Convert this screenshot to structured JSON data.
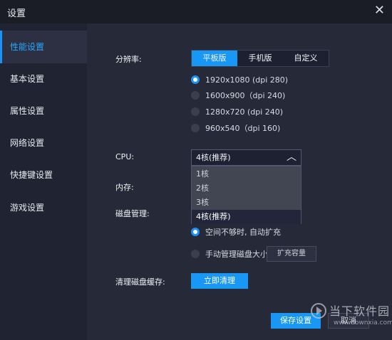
{
  "window": {
    "title": "设置",
    "close_glyph": "✕"
  },
  "sidebar": {
    "items": [
      {
        "label": "性能设置",
        "active": true
      },
      {
        "label": "基本设置"
      },
      {
        "label": "属性设置"
      },
      {
        "label": "网络设置"
      },
      {
        "label": "快捷键设置"
      },
      {
        "label": "游戏设置"
      }
    ]
  },
  "resolution": {
    "label": "分辨率:",
    "modes": [
      "平板版",
      "手机版",
      "自定义"
    ],
    "active_mode": "平板版",
    "options": [
      "1920x1080 (dpi 280)",
      "1600x900（dpi 240)",
      "1280x720 (dpi 240)",
      "960x540（dpi 160)"
    ],
    "selected": "1920x1080 (dpi 280)"
  },
  "cpu": {
    "label": "CPU:",
    "value": "4核(推荐)",
    "options": [
      "1核",
      "2核",
      "3核",
      "4核(推荐)"
    ]
  },
  "memory": {
    "label": "内存:"
  },
  "disk": {
    "label": "磁盘管理:",
    "auto_option": "空间不够时, 自动扩充",
    "manual_option": "手动管理磁盘大小",
    "expand_button": "扩充容量"
  },
  "cache": {
    "label": "清理磁盘缓存:",
    "button": "立即清理"
  },
  "footer": {
    "save_button": "保存设置",
    "cancel_button": "取消"
  },
  "watermark": {
    "text": "当下软件园",
    "url": "www.downxia.com"
  },
  "colors": {
    "accent": "#1997f5",
    "sidebar_bg": "#202331",
    "main_bg": "#262938"
  }
}
